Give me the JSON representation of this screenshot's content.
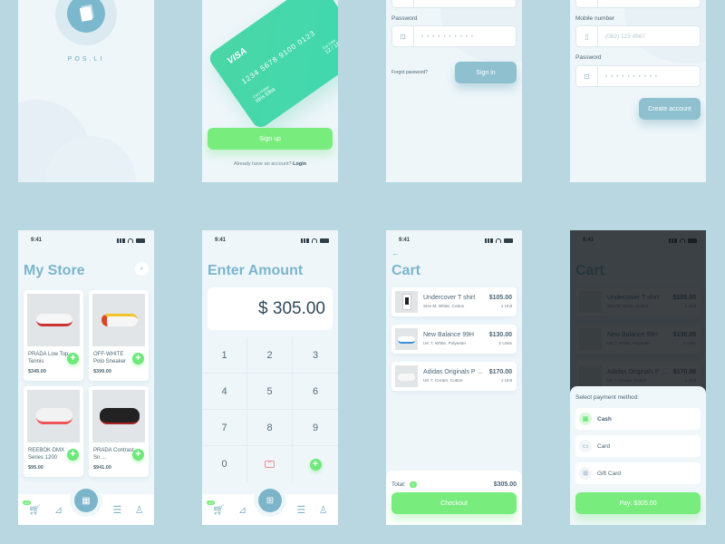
{
  "splash": {
    "brand": "POS.LI"
  },
  "signup": {
    "card": {
      "brand": "VISA",
      "number": "1234 5678 9100 0123",
      "holder_label": "Card Holder",
      "holder": "Idris Elba",
      "exp_label": "Exp Date",
      "exp": "12 / 18"
    },
    "button": "Sign up",
    "login_prompt": "Already have an account?",
    "login_link": "Login"
  },
  "signin": {
    "password_label": "Password",
    "password_value": "• • • • • • • • • •",
    "forgot": "Forgot password?",
    "button": "Sign in"
  },
  "register": {
    "mobile_label": "Mobile number",
    "mobile_placeholder": "(082) 123 4567",
    "password_label": "Password",
    "password_value": "• • • • • • • • • •",
    "button": "Create account"
  },
  "status": {
    "time": "9:41"
  },
  "store": {
    "title": "My Store",
    "products": [
      {
        "name": "PRADA Low Top Tennis",
        "price": "$345.00"
      },
      {
        "name": "OFF-WHITE Polo Sneaker",
        "price": "$399.00"
      },
      {
        "name": "REEBOK DMX Series 1200",
        "price": "$95.00"
      },
      {
        "name": "PRADA Contrast Sn ...",
        "price": "$941.00"
      }
    ]
  },
  "nav": {
    "cart_badge": "12"
  },
  "amount": {
    "title": "Enter Amount",
    "value": "$ 305.00",
    "keys": [
      "1",
      "2",
      "3",
      "4",
      "5",
      "6",
      "7",
      "8",
      "9",
      "0"
    ]
  },
  "cart": {
    "title": "Cart",
    "items": [
      {
        "name": "Undercover T shirt",
        "desc": "Size M, White, Cotton",
        "price": "$105.00",
        "units": "1 Unit"
      },
      {
        "name": "New Balance 99H",
        "desc": "UK 7, White, Polyester",
        "price": "$130.00",
        "units": "2 Units"
      },
      {
        "name": "Adidas Originals P ...",
        "desc": "UK 7, Cream, Cotton",
        "price": "$170.00",
        "units": "1 Unit"
      }
    ],
    "total_label": "Total:",
    "total_badge": "3",
    "total": "$305.00",
    "checkout": "Checkout"
  },
  "payment": {
    "heading": "Select payment method:",
    "options": [
      "Cash",
      "Card",
      "Gift Card"
    ],
    "pay_button": "Pay: $305.00"
  }
}
